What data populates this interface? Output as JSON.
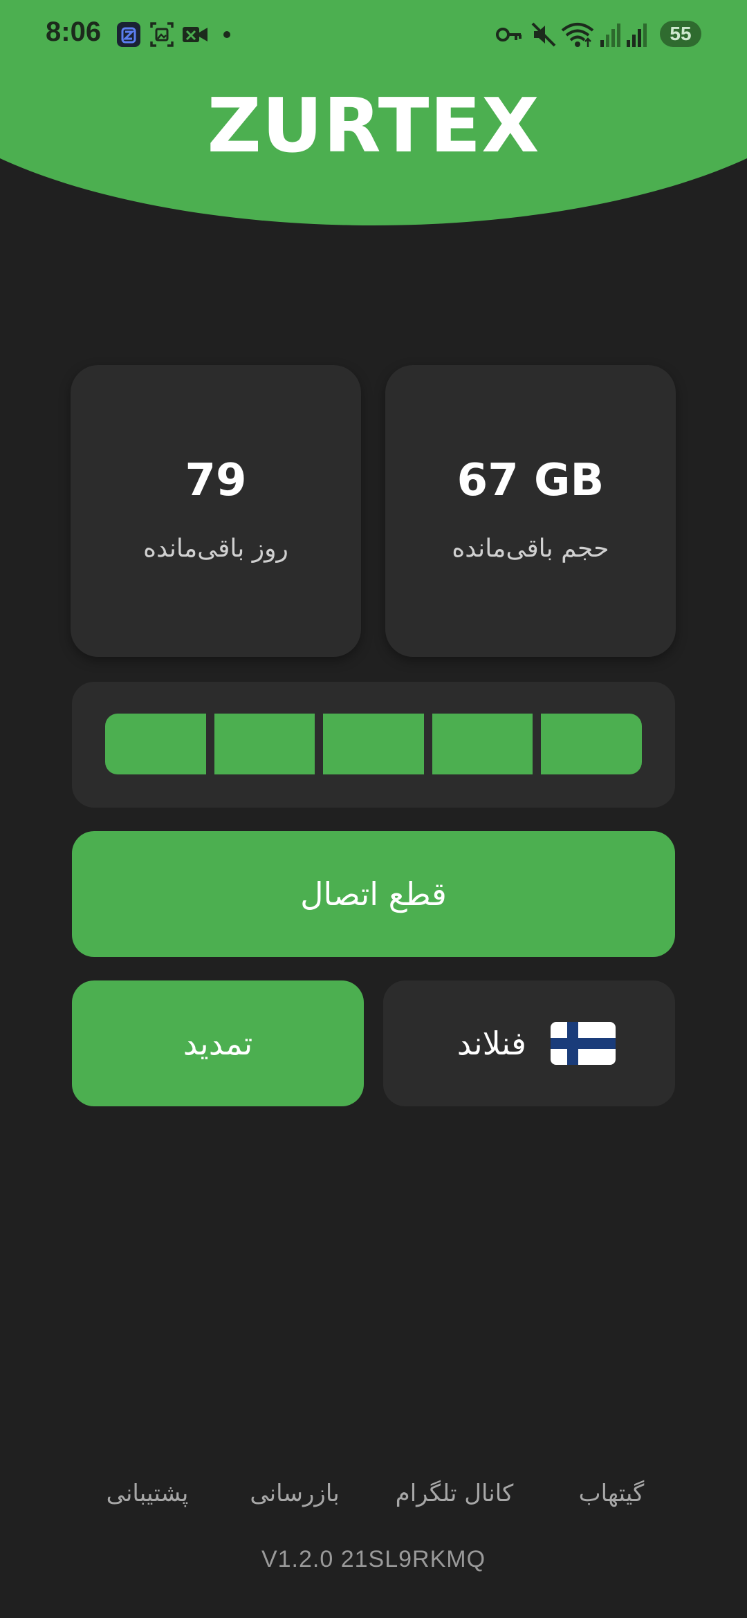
{
  "status_bar": {
    "time": "8:06",
    "battery": "55",
    "icons": [
      "vpn-app-icon",
      "screenshot-icon",
      "video-off-icon",
      "dot-icon",
      "vpn-key-icon",
      "mute-icon",
      "wifi-icon",
      "signal-1-icon",
      "signal-2-icon"
    ]
  },
  "header": {
    "title": "ZURTEX"
  },
  "stats": {
    "days": {
      "value": "79",
      "label": "روز باقی‌مانده"
    },
    "volume": {
      "value": "67 GB",
      "label": "حجم باقی‌مانده"
    }
  },
  "progress": {
    "segments_filled": 5,
    "segments_total": 5
  },
  "actions": {
    "disconnect_label": "قطع اتصال",
    "renew_label": "تمدید",
    "server_label": "فنلاند",
    "server_flag": "finland-flag-icon"
  },
  "footer": {
    "links": [
      "پشتیبانی",
      "بازرسانی",
      "کانال تلگرام",
      "گیتهاب"
    ],
    "version": "V1.2.0  21SL9RKMQ"
  },
  "colors": {
    "accent": "#4caf50",
    "background": "#202020",
    "card": "#2c2c2c",
    "text_primary": "#ffffff",
    "text_secondary": "#a7a7a7"
  }
}
